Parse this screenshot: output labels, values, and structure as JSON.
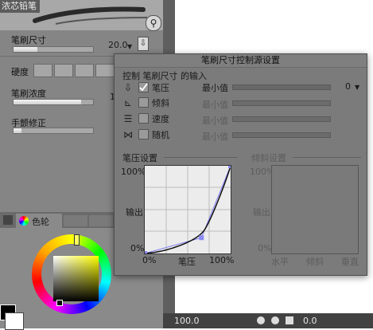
{
  "tool_panel": {
    "brush_name": "浓芯铅笔",
    "brush_size_label": "笔刷尺寸",
    "brush_size_value": "20.0",
    "brush_size_fill": 0.3,
    "hardness_label": "硬度",
    "density_label": "笔刷浓度",
    "density_value": "1",
    "density_fill": 0.85,
    "stabilization_label": "手颤修正",
    "stabilization_fill": 0.1,
    "color_tab_label": "色轮",
    "color_values": {
      "hue_marker": "yellow"
    }
  },
  "status_bar": {
    "zoom": "100.0",
    "angle": "0.0"
  },
  "dialog": {
    "title": "笔刷尺寸控制源设置",
    "subtitle": "控制 笔刷尺寸 的输入",
    "rows": [
      {
        "icon": "pen-pressure-icon",
        "label": "笔压",
        "checked": true,
        "min_label": "最小值",
        "value": "0",
        "enabled": true
      },
      {
        "icon": "tilt-icon",
        "label": "倾斜",
        "checked": false,
        "min_label": "最小值",
        "enabled": false
      },
      {
        "icon": "speed-icon",
        "label": "速度",
        "checked": false,
        "min_label": "最小值",
        "enabled": false
      },
      {
        "icon": "random-icon",
        "label": "随机",
        "checked": false,
        "min_label": "最小值",
        "enabled": false
      }
    ],
    "pressure_section": {
      "title": "笔压设置",
      "y_top": "100%",
      "y_mid": "输出",
      "y_bottom": "0%",
      "x_left": "0%",
      "x_mid": "笔压",
      "x_right": "100%",
      "curve_points": [
        [
          0,
          0
        ],
        [
          0.66,
          0.18
        ],
        [
          1,
          1
        ]
      ]
    },
    "tilt_section": {
      "title": "倾斜设置",
      "y_top": "100%",
      "y_mid": "输出",
      "y_bottom": "0%",
      "x_left": "水平",
      "x_mid": "倾斜",
      "x_right": "垂直"
    }
  }
}
